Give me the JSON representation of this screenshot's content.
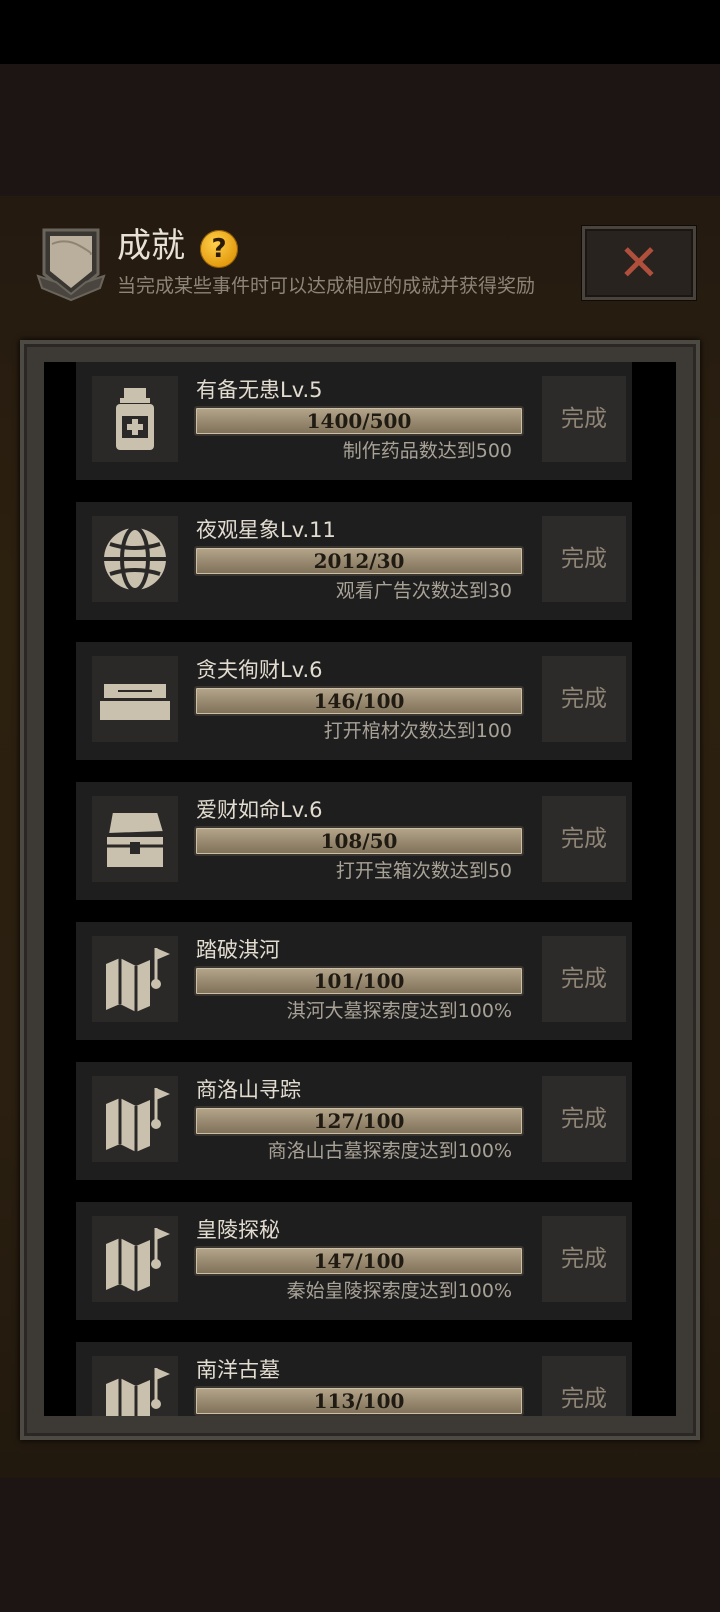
{
  "header": {
    "title": "成就",
    "help_symbol": "?",
    "subtitle": "当完成某些事件时可以达成相应的成就并获得奖励",
    "close_symbol": "✕"
  },
  "colors": {
    "panel": "#2a1f10",
    "card": "#1f1e1e",
    "bar": "#9c8d73",
    "close_x": "#b0503c",
    "help": "#f0b020"
  },
  "achievements": [
    {
      "icon": "medicine-bottle-icon",
      "name": "有备无患Lv.5",
      "progress": "1400/500",
      "desc": "制作药品数达到500",
      "button": "完成"
    },
    {
      "icon": "globe-icon",
      "name": "夜观星象Lv.11",
      "progress": "2012/30",
      "desc": "观看广告次数达到30",
      "button": "完成"
    },
    {
      "icon": "coffin-icon",
      "name": "贪夫徇财Lv.6",
      "progress": "146/100",
      "desc": "打开棺材次数达到100",
      "button": "完成"
    },
    {
      "icon": "treasure-chest-icon",
      "name": "爱财如命Lv.6",
      "progress": "108/50",
      "desc": "打开宝箱次数达到50",
      "button": "完成"
    },
    {
      "icon": "map-flag-icon",
      "name": "踏破淇河",
      "progress": "101/100",
      "desc": "淇河大墓探索度达到100%",
      "button": "完成"
    },
    {
      "icon": "map-flag-icon",
      "name": "商洛山寻踪",
      "progress": "127/100",
      "desc": "商洛山古墓探索度达到100%",
      "button": "完成"
    },
    {
      "icon": "map-flag-icon",
      "name": "皇陵探秘",
      "progress": "147/100",
      "desc": "秦始皇陵探索度达到100%",
      "button": "完成"
    },
    {
      "icon": "map-flag-icon",
      "name": "南洋古墓",
      "progress": "113/100",
      "desc": "",
      "button": "完成"
    }
  ]
}
